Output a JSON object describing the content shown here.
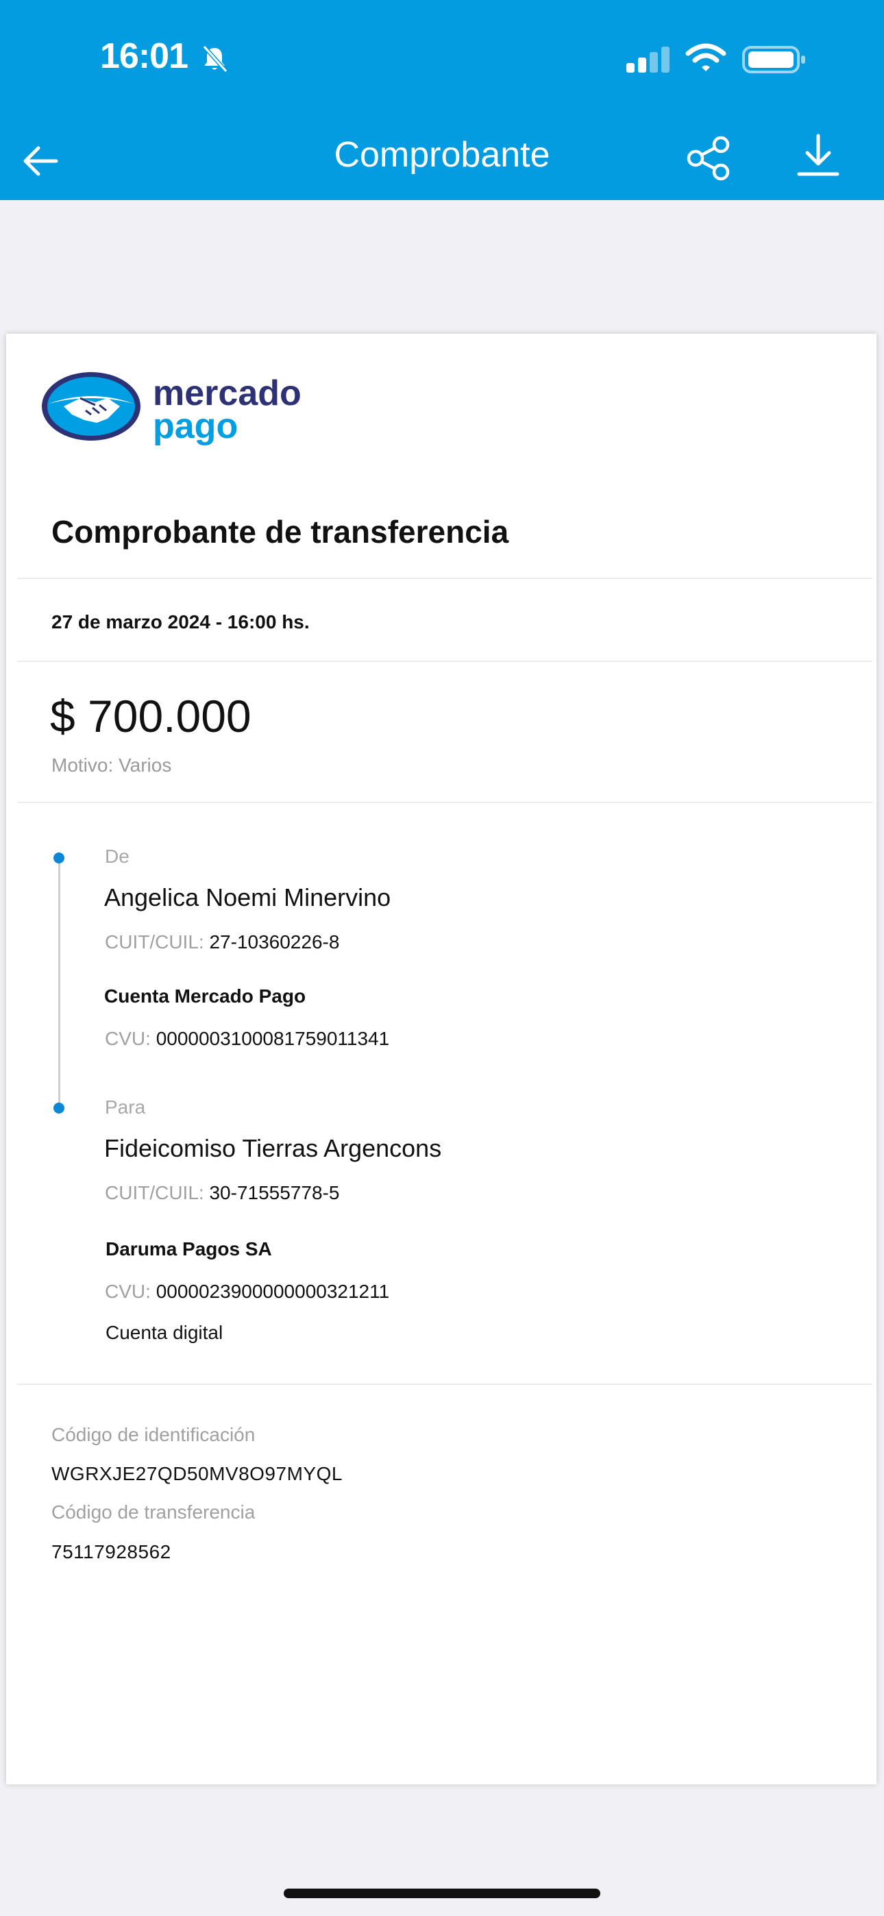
{
  "status_bar": {
    "time": "16:01"
  },
  "nav": {
    "title": "Comprobante",
    "back_icon": "arrow-left-icon",
    "share_icon": "share-icon",
    "download_icon": "download-icon"
  },
  "brand": {
    "line1": "mercado",
    "line2": "pago",
    "colors": {
      "navy": "#2d3277",
      "blue": "#009ee3",
      "header": "#039ce0"
    }
  },
  "receipt": {
    "title": "Comprobante de transferencia",
    "date": "27 de marzo 2024 - 16:00 hs.",
    "amount": "$ 700.000",
    "reason": "Motivo: Varios"
  },
  "from": {
    "label": "De",
    "name": "Angelica Noemi Minervino",
    "cuit_label": "CUIT/CUIL:",
    "cuit_value": "27-10360226-8",
    "bank": "Cuenta Mercado Pago",
    "cvu_label": "CVU:",
    "cvu_value": "0000003100081759011341"
  },
  "to": {
    "label": "Para",
    "name": "Fideicomiso Tierras Argencons",
    "cuit_label": "CUIT/CUIL:",
    "cuit_value": "30-71555778-5",
    "bank": "Daruma Pagos SA",
    "cvu_label": "CVU:",
    "cvu_value": "0000023900000000321211",
    "account_type": "Cuenta digital"
  },
  "codes": {
    "id_label": "Código de identificación",
    "id_value": "WGRXJE27QD50MV8O97MYQL",
    "transfer_label": "Código de transferencia",
    "transfer_value": "75117928562"
  }
}
